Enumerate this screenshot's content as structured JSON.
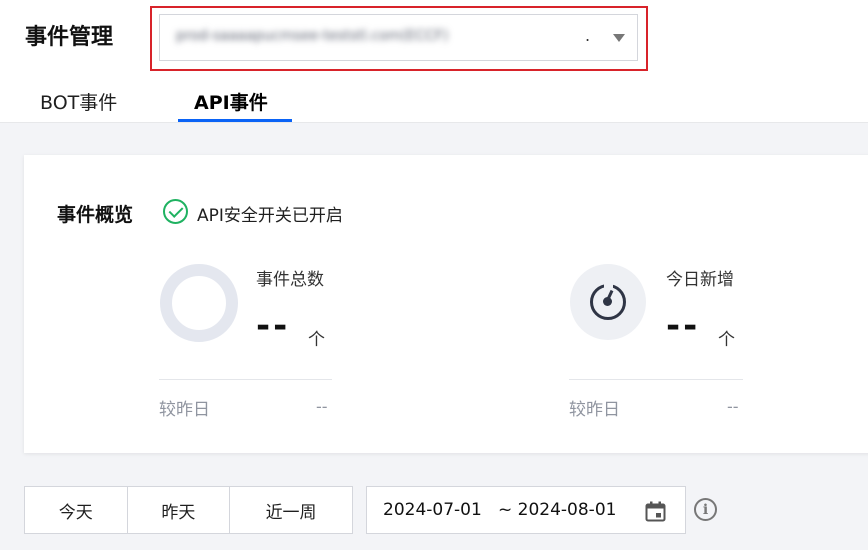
{
  "page_title": "事件管理",
  "domain_select": {
    "value": "prod-saaaapucmsee-teststl.com(ECCF)",
    "suffix": "."
  },
  "tabs": [
    {
      "label": "BOT事件",
      "active": false
    },
    {
      "label": "API事件",
      "active": true
    }
  ],
  "overview": {
    "title": "事件概览",
    "status_text": "API安全开关已开启",
    "status_color": "#1fb261",
    "metrics": [
      {
        "label": "事件总数",
        "value": "--",
        "unit": "个",
        "compare_label": "较昨日",
        "compare_value": "--",
        "icon": "ring-chart-icon"
      },
      {
        "label": "今日新增",
        "value": "--",
        "unit": "个",
        "compare_label": "较昨日",
        "compare_value": "--",
        "icon": "gauge-icon"
      }
    ]
  },
  "filters": {
    "ranges": [
      "今天",
      "昨天",
      "近一周"
    ],
    "date_range": "2024-07-01   ~ 2024-08-01",
    "calendar_icon": "calendar-icon",
    "info_icon": "info-icon"
  },
  "colors": {
    "accent": "#0a63f6",
    "highlight_border": "#d8232a"
  }
}
